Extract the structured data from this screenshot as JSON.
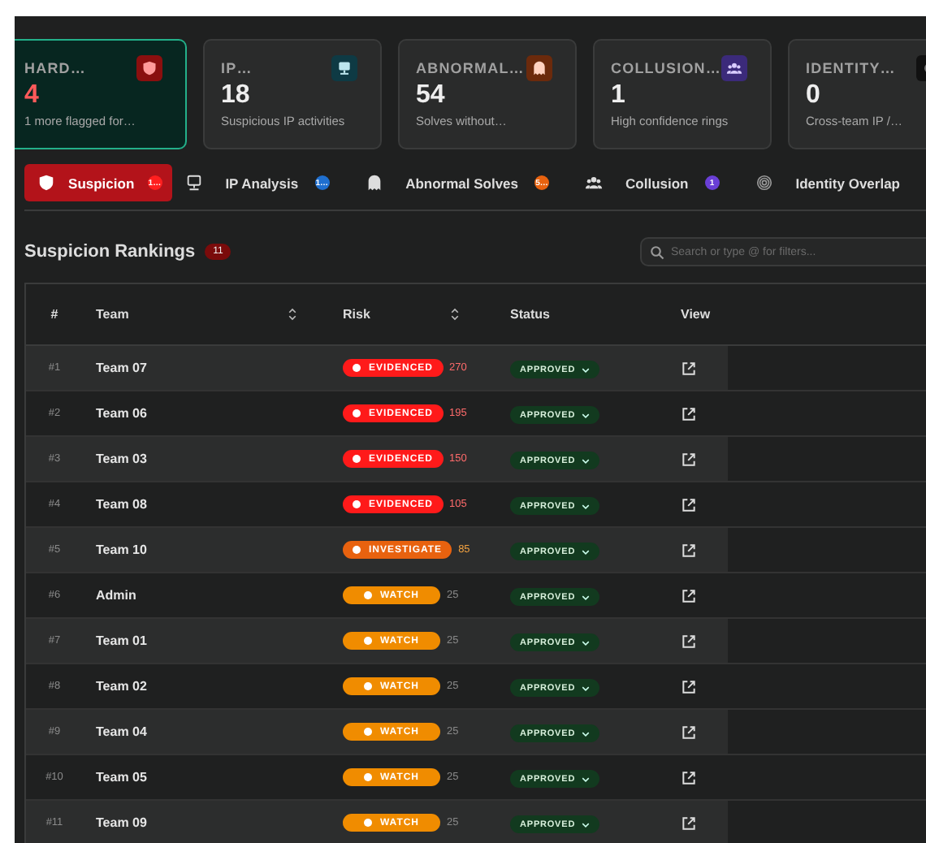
{
  "cards": [
    {
      "title": "HARD…",
      "value": "4",
      "subtitle": "1 more flagged for…",
      "selected": true,
      "color": "#8a0f0f",
      "kind": "shield"
    },
    {
      "title": "IP…",
      "value": "18",
      "subtitle": "Suspicious IP activities",
      "selected": false,
      "color": "#0e3a44",
      "kind": "monitor"
    },
    {
      "title": "ABNORMAL…",
      "value": "54",
      "subtitle": "Solves without…",
      "selected": false,
      "color": "#6b2a0c",
      "kind": "ghost"
    },
    {
      "title": "COLLUSION…",
      "value": "1",
      "subtitle": "High confidence rings",
      "selected": false,
      "color": "#3b2a7a",
      "kind": "people"
    },
    {
      "title": "IDENTITY…",
      "value": "0",
      "subtitle": "Cross-team IP /…",
      "selected": false,
      "color": "#111111",
      "kind": "fingerprint"
    }
  ],
  "tabs": [
    {
      "label": "Suspicion",
      "selected": true,
      "kind": "shield",
      "badge": "1…",
      "color": "#ff1f1f"
    },
    {
      "label": "IP Analysis",
      "selected": false,
      "kind": "monitor",
      "badge": "1…",
      "color": "#1f6fcf"
    },
    {
      "label": "Abnormal Solves",
      "selected": false,
      "kind": "ghost",
      "badge": "5…",
      "color": "#e8620f"
    },
    {
      "label": "Collusion",
      "selected": false,
      "kind": "people",
      "badge": "1",
      "color": "#6a3fd6"
    },
    {
      "label": "Identity Overlap",
      "selected": false,
      "kind": "fingerprint"
    }
  ],
  "section": {
    "title": "Suspicion Rankings",
    "count": "11"
  },
  "search": {
    "placeholder": "Search or type @ for filters..."
  },
  "table": {
    "columns": [
      {
        "label": "#",
        "sortable": false
      },
      {
        "label": "Team",
        "sortable": true
      },
      {
        "label": "Risk",
        "sortable": true
      },
      {
        "label": "Status",
        "sortable": false
      },
      {
        "label": "View",
        "sortable": false
      }
    ],
    "rows": [
      {
        "rank": "#1",
        "team": "Team 07",
        "risk": "EVIDENCED",
        "kind": "evidenced",
        "score": "270",
        "status": "APPROVED"
      },
      {
        "rank": "#2",
        "team": "Team 06",
        "risk": "EVIDENCED",
        "kind": "evidenced",
        "score": "195",
        "status": "APPROVED"
      },
      {
        "rank": "#3",
        "team": "Team 03",
        "risk": "EVIDENCED",
        "kind": "evidenced",
        "score": "150",
        "status": "APPROVED"
      },
      {
        "rank": "#4",
        "team": "Team 08",
        "risk": "EVIDENCED",
        "kind": "evidenced",
        "score": "105",
        "status": "APPROVED"
      },
      {
        "rank": "#5",
        "team": "Team 10",
        "risk": "INVESTIGATE",
        "kind": "investigate",
        "score": "85",
        "status": "APPROVED"
      },
      {
        "rank": "#6",
        "team": "Admin",
        "risk": "WATCH",
        "kind": "watch",
        "score": "25",
        "status": "APPROVED"
      },
      {
        "rank": "#7",
        "team": "Team 01",
        "risk": "WATCH",
        "kind": "watch",
        "score": "25",
        "status": "APPROVED"
      },
      {
        "rank": "#8",
        "team": "Team 02",
        "risk": "WATCH",
        "kind": "watch",
        "score": "25",
        "status": "APPROVED"
      },
      {
        "rank": "#9",
        "team": "Team 04",
        "risk": "WATCH",
        "kind": "watch",
        "score": "25",
        "status": "APPROVED"
      },
      {
        "rank": "#10",
        "team": "Team 05",
        "risk": "WATCH",
        "kind": "watch",
        "score": "25",
        "status": "APPROVED"
      },
      {
        "rank": "#11",
        "team": "Team 09",
        "risk": "WATCH",
        "kind": "watch",
        "score": "25",
        "status": "APPROVED"
      }
    ]
  }
}
